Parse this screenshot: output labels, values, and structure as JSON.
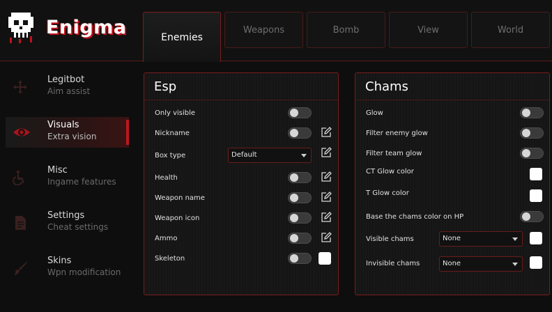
{
  "brand": {
    "name": "Enigma",
    "accent": "#c2111c"
  },
  "tabs": [
    {
      "label": "Enemies",
      "active": true
    },
    {
      "label": "Weapons",
      "active": false
    },
    {
      "label": "Bomb",
      "active": false
    },
    {
      "label": "View",
      "active": false
    },
    {
      "label": "World",
      "active": false
    }
  ],
  "sidebar": {
    "items": [
      {
        "title": "Legitbot",
        "subtitle": "Aim assist",
        "icon": "crosshair-icon"
      },
      {
        "title": "Visuals",
        "subtitle": "Extra vision",
        "icon": "eye-icon",
        "active": true
      },
      {
        "title": "Misc",
        "subtitle": "Ingame features",
        "icon": "wheelchair-icon"
      },
      {
        "title": "Settings",
        "subtitle": "Cheat settings",
        "icon": "document-icon"
      },
      {
        "title": "Skins",
        "subtitle": "Wpn modification",
        "icon": "brush-icon"
      }
    ]
  },
  "esp": {
    "title": "Esp",
    "only_visible": "Only visible",
    "nickname": "Nickname",
    "box_type": "Box type",
    "box_type_value": "Default",
    "health": "Health",
    "weapon_name": "Weapon name",
    "weapon_icon": "Weapon icon",
    "ammo": "Ammo",
    "skeleton": "Skeleton"
  },
  "chams": {
    "title": "Chams",
    "glow": "Glow",
    "filter_enemy_glow": "Filter enemy glow",
    "filter_team_glow": "Filter team glow",
    "ct_glow_color": "CT Glow color",
    "t_glow_color": "T Glow color",
    "base_chams_hp": "Base the chams color on HP",
    "visible_chams": "Visible chams",
    "visible_chams_value": "None",
    "invisible_chams": "Invisible chams",
    "invisible_chams_value": "None"
  }
}
